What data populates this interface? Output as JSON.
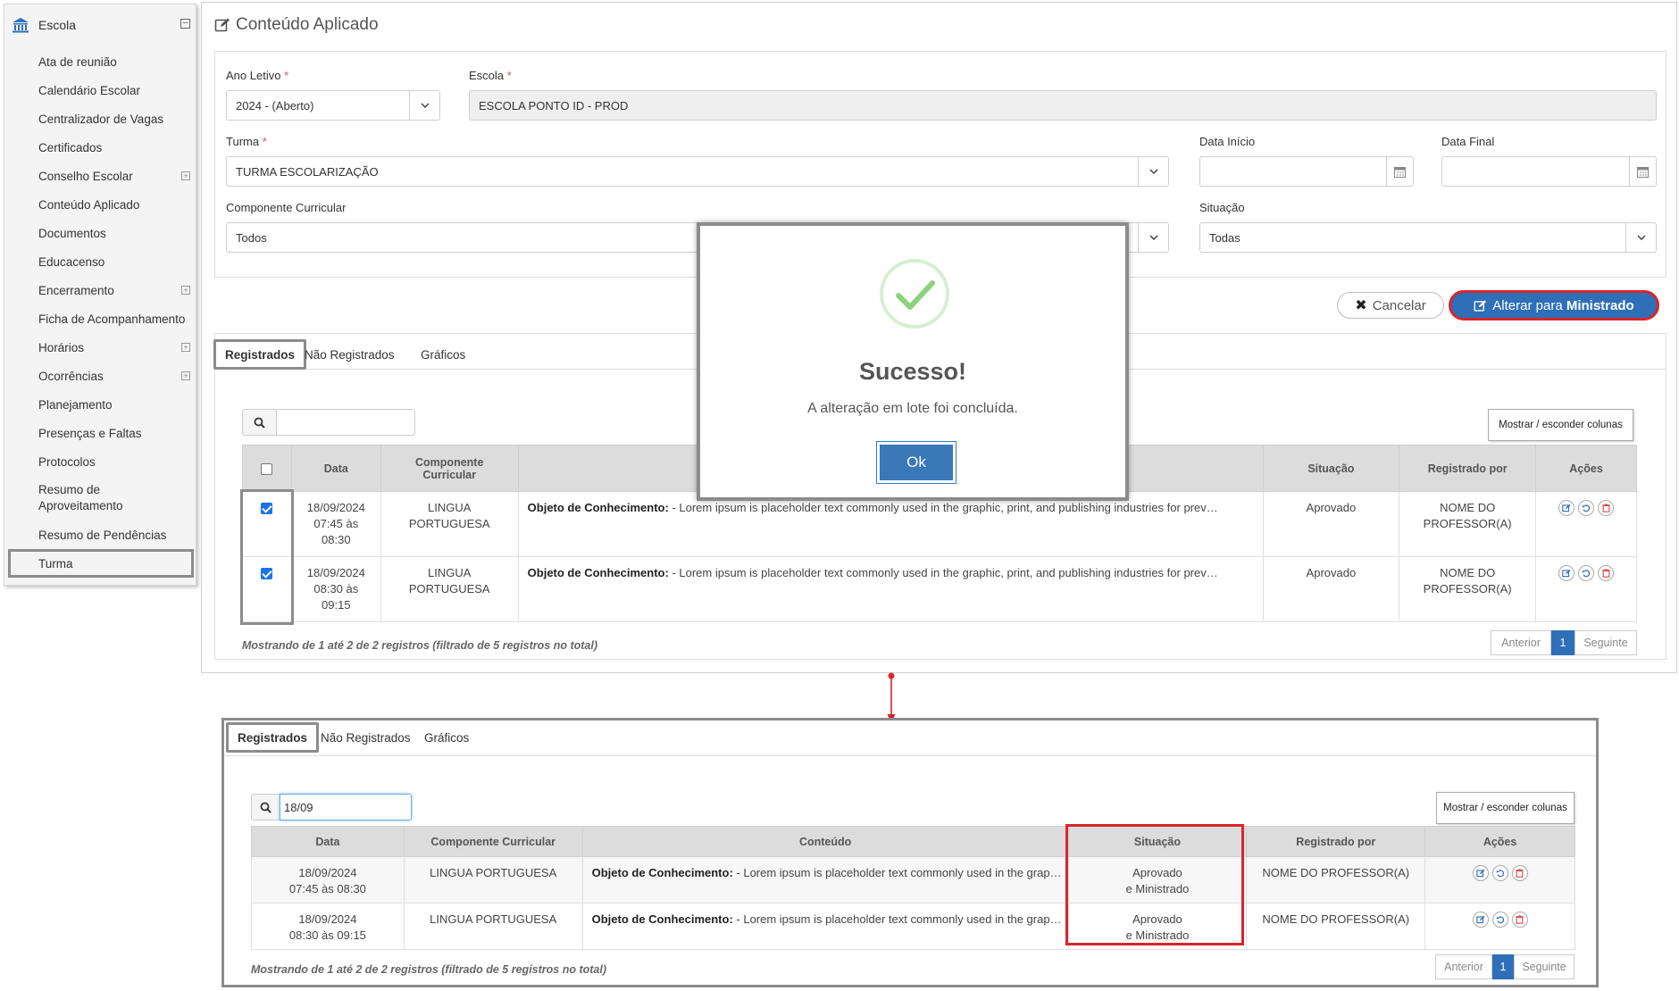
{
  "sidebar": {
    "header": "Escola",
    "collapse_symbol": "⊟",
    "items": [
      {
        "label": "Ata de reunião",
        "expand": false
      },
      {
        "label": "Calendário Escolar",
        "expand": false
      },
      {
        "label": "Centralizador de Vagas",
        "expand": false
      },
      {
        "label": "Certificados",
        "expand": false
      },
      {
        "label": "Conselho Escolar",
        "expand": true
      },
      {
        "label": "Conteúdo Aplicado",
        "expand": false
      },
      {
        "label": "Documentos",
        "expand": false
      },
      {
        "label": "Educacenso",
        "expand": false
      },
      {
        "label": "Encerramento",
        "expand": true
      },
      {
        "label": "Ficha de Acompanhamento",
        "expand": false
      },
      {
        "label": "Horários",
        "expand": true
      },
      {
        "label": "Ocorrências",
        "expand": true
      },
      {
        "label": "Planejamento",
        "expand": false
      },
      {
        "label": "Presenças e Faltas",
        "expand": false
      },
      {
        "label": "Protocolos",
        "expand": false
      },
      {
        "label": "Resumo de Aproveitamento",
        "expand": false
      },
      {
        "label": "Resumo de Pendências",
        "expand": false
      },
      {
        "label": "Turma",
        "expand": false
      }
    ],
    "plus_symbol": "+"
  },
  "page": {
    "title": "Conteúdo Aplicado"
  },
  "form": {
    "ano_letivo": {
      "label": "Ano Letivo",
      "value": "2024 - (Aberto)"
    },
    "escola": {
      "label": "Escola",
      "value": "ESCOLA PONTO ID - PROD"
    },
    "turma": {
      "label": "Turma",
      "value": "TURMA ESCOLARIZAÇÃO"
    },
    "data_inicio": {
      "label": "Data Início",
      "value": ""
    },
    "data_final": {
      "label": "Data Final",
      "value": ""
    },
    "componente": {
      "label": "Componente Curricular",
      "value": "Todos"
    },
    "situacao": {
      "label": "Situação",
      "value": "Todas"
    },
    "required_mark": "*"
  },
  "actions": {
    "cancel": "Cancelar",
    "cancel_icon": "✖",
    "alter_prefix": "Alterar para ",
    "alter_bold": "Ministrado"
  },
  "tabs": [
    "Registrados",
    "Não Registrados",
    "Gráficos"
  ],
  "top_table": {
    "search_value": "",
    "columns_button": "Mostrar / esconder colunas",
    "headers": {
      "data": "Data",
      "componente": "Componente Curricular",
      "situacao": "Situação",
      "registrado_por": "Registrado por",
      "acoes": "Ações"
    },
    "rows": [
      {
        "date": "18/09/2024",
        "time1": "07:45 às",
        "time2": "08:30",
        "comp1": "LINGUA",
        "comp2": "PORTUGUESA",
        "content_label": "Objeto de Conhecimento:",
        "content_text": " - Lorem ipsum is placeholder text commonly used in the graphic, print, and publishing industries for prev…",
        "status": "Aprovado",
        "prof1": "NOME DO",
        "prof2": "PROFESSOR(A)",
        "checked": true
      },
      {
        "date": "18/09/2024",
        "time1": "08:30 às",
        "time2": "09:15",
        "comp1": "LINGUA",
        "comp2": "PORTUGUESA",
        "content_label": "Objeto de Conhecimento:",
        "content_text": " - Lorem ipsum is placeholder text commonly used in the graphic, print, and publishing industries for prev…",
        "status": "Aprovado",
        "prof1": "NOME DO",
        "prof2": "PROFESSOR(A)",
        "checked": true
      }
    ],
    "info": "Mostrando de 1 até 2 de 2 registros (filtrado de 5 registros no total)"
  },
  "pager": {
    "prev": "Anterior",
    "page": "1",
    "next": "Seguinte"
  },
  "modal": {
    "title": "Sucesso!",
    "message": "A alteração em lote foi concluída.",
    "ok": "Ok",
    "accent": "#8bd37d"
  },
  "bottom_table": {
    "search_value": "18/09",
    "columns_button": "Mostrar / esconder colunas",
    "headers": {
      "data": "Data",
      "componente": "Componente Curricular",
      "conteudo": "Conteúdo",
      "situacao": "Situação",
      "registrado_por": "Registrado por",
      "acoes": "Ações"
    },
    "rows": [
      {
        "date": "18/09/2024",
        "time": "07:45 às 08:30",
        "comp": "LINGUA PORTUGUESA",
        "content_label": "Objeto de Conhecimento:",
        "content_text": " - Lorem ipsum is placeholder text commonly used in the grap…",
        "status1": "Aprovado",
        "status2": "e Ministrado",
        "prof": "NOME DO PROFESSOR(A)"
      },
      {
        "date": "18/09/2024",
        "time": "08:30 às 09:15",
        "comp": "LINGUA PORTUGUESA",
        "content_label": "Objeto de Conhecimento:",
        "content_text": " - Lorem ipsum is placeholder text commonly used in the grap…",
        "status1": "Aprovado",
        "status2": "e Ministrado",
        "prof": "NOME DO PROFESSOR(A)"
      }
    ],
    "info": "Mostrando de 1 até 2 de 2 registros (filtrado de 5 registros no total)"
  },
  "colors": {
    "primary": "#2e6fb8",
    "highlight_red": "#d9252b",
    "highlight_gray": "#8c8c8c"
  }
}
